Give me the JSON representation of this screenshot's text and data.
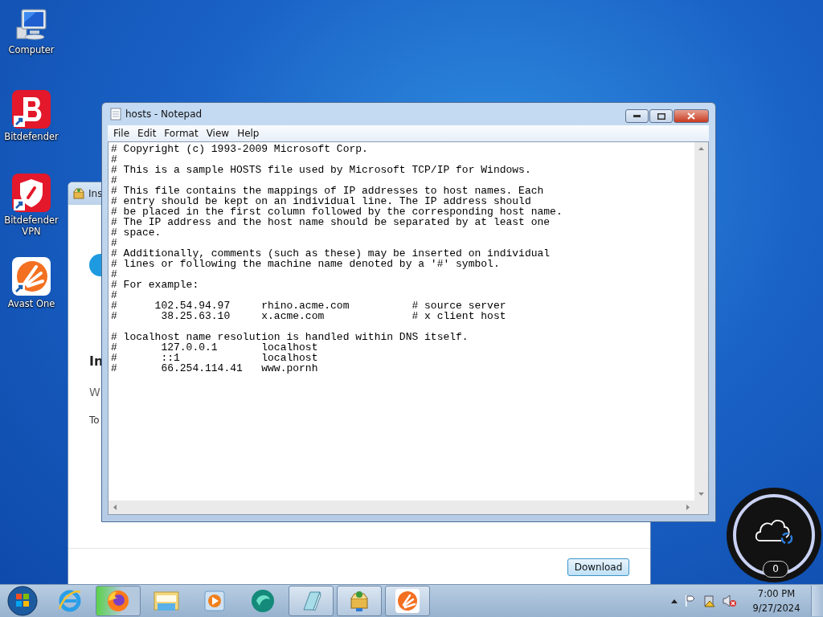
{
  "desktop_icons": [
    {
      "label": "Computer",
      "kind": "computer"
    },
    {
      "label": "Bitdefender",
      "kind": "bitdefender"
    },
    {
      "label": "Bitdefender VPN",
      "kind": "vpn"
    },
    {
      "label": "Avast One",
      "kind": "avast"
    }
  ],
  "installer_window": {
    "title": "Ins",
    "heading": "In",
    "line_1": "W",
    "line_2": "To",
    "button": "Download"
  },
  "notepad": {
    "title": "hosts - Notepad",
    "menu": [
      "File",
      "Edit",
      "Format",
      "View",
      "Help"
    ],
    "text": "# Copyright (c) 1993-2009 Microsoft Corp.\n#\n# This is a sample HOSTS file used by Microsoft TCP/IP for Windows.\n#\n# This file contains the mappings of IP addresses to host names. Each\n# entry should be kept on an individual line. The IP address should\n# be placed in the first column followed by the corresponding host name.\n# The IP address and the host name should be separated by at least one\n# space.\n#\n# Additionally, comments (such as these) may be inserted on individual\n# lines or following the machine name denoted by a '#' symbol.\n#\n# For example:\n#\n#      102.54.94.97     rhino.acme.com          # source server\n#       38.25.63.10     x.acme.com              # x client host\n\n# localhost name resolution is handled within DNS itself.\n#       127.0.0.1       localhost\n#       ::1             localhost\n#       66.254.114.41   www.pornh"
  },
  "widget": {
    "count": "0"
  },
  "taskbar": {
    "apps": [
      {
        "kind": "ie",
        "open": false,
        "highlighted": false
      },
      {
        "kind": "firefox",
        "open": true,
        "highlighted": true
      },
      {
        "kind": "explorer",
        "open": false,
        "highlighted": false
      },
      {
        "kind": "media",
        "open": false,
        "highlighted": false
      },
      {
        "kind": "teal",
        "open": false,
        "highlighted": false
      },
      {
        "kind": "notepad",
        "open": true,
        "highlighted": false
      },
      {
        "kind": "installer",
        "open": true,
        "highlighted": false
      },
      {
        "kind": "avast",
        "open": true,
        "highlighted": false
      }
    ],
    "clock": {
      "time": "7:00 PM",
      "date": "9/27/2024"
    }
  }
}
